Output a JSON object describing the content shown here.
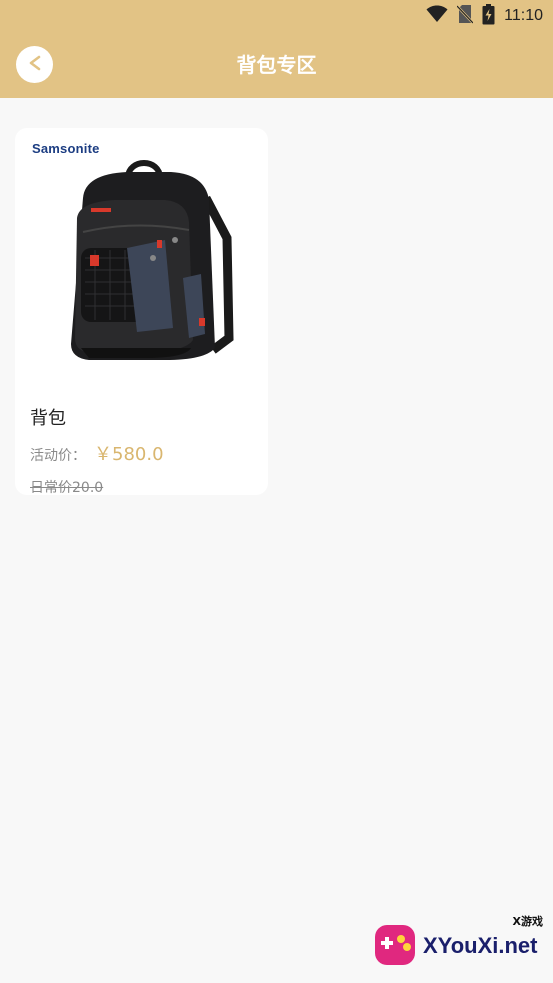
{
  "status_bar": {
    "time": "11:10",
    "icons": [
      "wifi-icon",
      "no-sim-icon",
      "battery-charging-icon"
    ]
  },
  "header": {
    "back_icon": "chevron-left-icon",
    "title": "背包专区"
  },
  "products": [
    {
      "brand": "Samsonite",
      "name": "背包",
      "price_label": "活动价：",
      "price_value": "￥580.0",
      "original_price": "日常价20.0"
    }
  ],
  "watermark": {
    "sub": "X游戏",
    "main": "XYouXi.net"
  },
  "colors": {
    "header_bg": "#e2c385",
    "page_bg": "#f8f8f8",
    "price": "#d9b66f",
    "brand": "#1c3d82"
  }
}
